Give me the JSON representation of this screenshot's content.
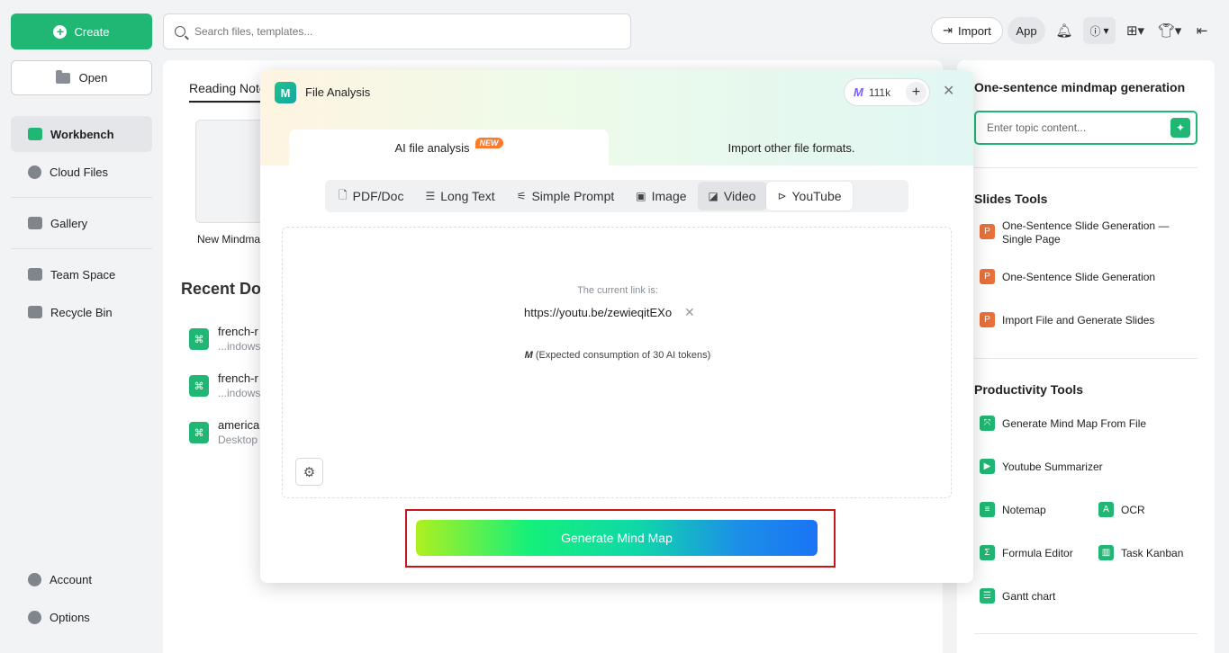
{
  "sidebar": {
    "create_label": "Create",
    "open_label": "Open",
    "items": [
      {
        "label": "Workbench"
      },
      {
        "label": "Cloud Files"
      },
      {
        "label": "Gallery"
      },
      {
        "label": "Team Space"
      },
      {
        "label": "Recycle Bin"
      },
      {
        "label": "Account"
      },
      {
        "label": "Options"
      }
    ]
  },
  "topbar": {
    "search_placeholder": "Search files, templates...",
    "import_label": "Import",
    "app_label": "App"
  },
  "main": {
    "tab_label": "Reading Note",
    "new_card_label": "New Mindma",
    "recent_title": "Recent Do",
    "docs": [
      {
        "name": "french-r",
        "path": "...indows"
      },
      {
        "name": "french-r",
        "path": "...indows"
      },
      {
        "name": "american",
        "path": "Desktop"
      }
    ]
  },
  "modal": {
    "title": "File Analysis",
    "tokens": "111k",
    "tab_ai": "AI file analysis",
    "new_badge": "NEW",
    "tab_other": "Import other file formats.",
    "segments": [
      {
        "label": "PDF/Doc"
      },
      {
        "label": "Long Text"
      },
      {
        "label": "Simple Prompt"
      },
      {
        "label": "Image"
      },
      {
        "label": "Video"
      },
      {
        "label": "YouTube"
      }
    ],
    "link_label": "The current link is:",
    "link_value": "https://youtu.be/zewieqitEXo",
    "consumption": "(Expected consumption of 30 AI tokens)",
    "generate_label": "Generate Mind Map"
  },
  "right_panel": {
    "title": "One-sentence mindmap generation",
    "topic_placeholder": "Enter topic content...",
    "slides_title": "Slides Tools",
    "slides_tools": [
      {
        "label": "One-Sentence Slide Generation — Single Page"
      },
      {
        "label": "One-Sentence Slide Generation"
      },
      {
        "label": "Import File and Generate Slides"
      }
    ],
    "productivity_title": "Productivity Tools",
    "productivity_tools": [
      {
        "label": "Generate Mind Map From File"
      },
      {
        "label": "Youtube Summarizer"
      },
      {
        "label": "Notemap"
      },
      {
        "label": "OCR"
      },
      {
        "label": "Formula Editor"
      },
      {
        "label": "Task Kanban"
      },
      {
        "label": "Gantt chart"
      }
    ]
  },
  "colors": {
    "accent": "#20b673",
    "highlight_border": "#c6171c"
  }
}
